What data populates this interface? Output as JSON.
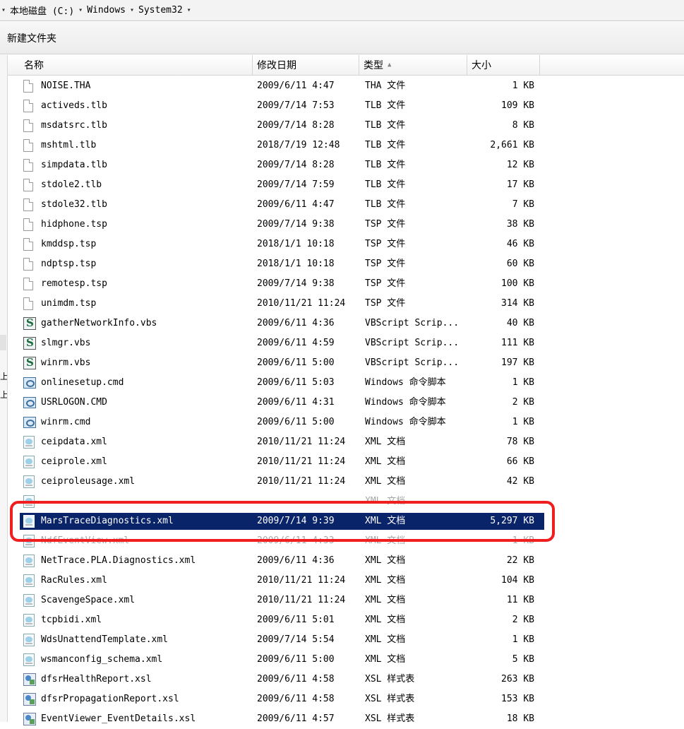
{
  "address_bar": {
    "crumbs": [
      "本地磁盘 (C:)",
      "Windows",
      "System32"
    ]
  },
  "toolbar": {
    "new_folder_label": "新建文件夹"
  },
  "columns": {
    "name": "名称",
    "date": "修改日期",
    "type": "类型",
    "size": "大小"
  },
  "sort_column": "type",
  "colors": {
    "selection": "#0a246a",
    "highlight_box": "#f01e1e"
  },
  "files": [
    {
      "name": "NOISE.THA",
      "date": "2009/6/11 4:47",
      "type": "THA 文件",
      "size": "1 KB",
      "icon": "file-icon"
    },
    {
      "name": "activeds.tlb",
      "date": "2009/7/14 7:53",
      "type": "TLB 文件",
      "size": "109 KB",
      "icon": "file-icon"
    },
    {
      "name": "msdatsrc.tlb",
      "date": "2009/7/14 8:28",
      "type": "TLB 文件",
      "size": "8 KB",
      "icon": "file-icon"
    },
    {
      "name": "mshtml.tlb",
      "date": "2018/7/19 12:48",
      "type": "TLB 文件",
      "size": "2,661 KB",
      "icon": "file-icon"
    },
    {
      "name": "simpdata.tlb",
      "date": "2009/7/14 8:28",
      "type": "TLB 文件",
      "size": "12 KB",
      "icon": "file-icon"
    },
    {
      "name": "stdole2.tlb",
      "date": "2009/7/14 7:59",
      "type": "TLB 文件",
      "size": "17 KB",
      "icon": "file-icon"
    },
    {
      "name": "stdole32.tlb",
      "date": "2009/6/11 4:47",
      "type": "TLB 文件",
      "size": "7 KB",
      "icon": "file-icon"
    },
    {
      "name": "hidphone.tsp",
      "date": "2009/7/14 9:38",
      "type": "TSP 文件",
      "size": "38 KB",
      "icon": "file-icon"
    },
    {
      "name": "kmddsp.tsp",
      "date": "2018/1/1 10:18",
      "type": "TSP 文件",
      "size": "46 KB",
      "icon": "file-icon"
    },
    {
      "name": "ndptsp.tsp",
      "date": "2018/1/1 10:18",
      "type": "TSP 文件",
      "size": "60 KB",
      "icon": "file-icon"
    },
    {
      "name": "remotesp.tsp",
      "date": "2009/7/14 9:38",
      "type": "TSP 文件",
      "size": "100 KB",
      "icon": "file-icon"
    },
    {
      "name": "unimdm.tsp",
      "date": "2010/11/21 11:24",
      "type": "TSP 文件",
      "size": "314 KB",
      "icon": "file-icon"
    },
    {
      "name": "gatherNetworkInfo.vbs",
      "date": "2009/6/11 4:36",
      "type": "VBScript Scrip...",
      "size": "40 KB",
      "icon": "vbscript-icon"
    },
    {
      "name": "slmgr.vbs",
      "date": "2009/6/11 4:59",
      "type": "VBScript Scrip...",
      "size": "111 KB",
      "icon": "vbscript-icon"
    },
    {
      "name": "winrm.vbs",
      "date": "2009/6/11 5:00",
      "type": "VBScript Scrip...",
      "size": "197 KB",
      "icon": "vbscript-icon"
    },
    {
      "name": "onlinesetup.cmd",
      "date": "2009/6/11 5:03",
      "type": "Windows 命令脚本",
      "size": "1 KB",
      "icon": "cmd-script-icon"
    },
    {
      "name": "USRLOGON.CMD",
      "date": "2009/6/11 4:31",
      "type": "Windows 命令脚本",
      "size": "2 KB",
      "icon": "cmd-script-icon"
    },
    {
      "name": "winrm.cmd",
      "date": "2009/6/11 5:00",
      "type": "Windows 命令脚本",
      "size": "1 KB",
      "icon": "cmd-script-icon"
    },
    {
      "name": "ceipdata.xml",
      "date": "2010/11/21 11:24",
      "type": "XML 文档",
      "size": "78 KB",
      "icon": "xml-document-icon"
    },
    {
      "name": "ceiprole.xml",
      "date": "2010/11/21 11:24",
      "type": "XML 文档",
      "size": "66 KB",
      "icon": "xml-document-icon"
    },
    {
      "name": "ceiproleusage.xml",
      "date": "2010/11/21 11:24",
      "type": "XML 文档",
      "size": "42 KB",
      "icon": "xml-document-icon"
    },
    {
      "name": "",
      "date": "",
      "type": "XML 文档",
      "size": "",
      "icon": "xml-document-icon",
      "obscured": true
    },
    {
      "name": "MarsTraceDiagnostics.xml",
      "date": "2009/7/14 9:39",
      "type": "XML 文档",
      "size": "5,297 KB",
      "icon": "xml-document-icon",
      "selected": true
    },
    {
      "name": "NdfEventView.xml",
      "date": "2009/6/11 4:33",
      "type": "XML 文档",
      "size": "1 KB",
      "icon": "xml-document-icon",
      "obscured": true
    },
    {
      "name": "NetTrace.PLA.Diagnostics.xml",
      "date": "2009/6/11 4:36",
      "type": "XML 文档",
      "size": "22 KB",
      "icon": "xml-document-icon"
    },
    {
      "name": "RacRules.xml",
      "date": "2010/11/21 11:24",
      "type": "XML 文档",
      "size": "104 KB",
      "icon": "xml-document-icon"
    },
    {
      "name": "ScavengeSpace.xml",
      "date": "2010/11/21 11:24",
      "type": "XML 文档",
      "size": "11 KB",
      "icon": "xml-document-icon"
    },
    {
      "name": "tcpbidi.xml",
      "date": "2009/6/11 5:01",
      "type": "XML 文档",
      "size": "2 KB",
      "icon": "xml-document-icon"
    },
    {
      "name": "WdsUnattendTemplate.xml",
      "date": "2009/7/14 5:54",
      "type": "XML 文档",
      "size": "1 KB",
      "icon": "xml-document-icon"
    },
    {
      "name": "wsmanconfig_schema.xml",
      "date": "2009/6/11 5:00",
      "type": "XML 文档",
      "size": "5 KB",
      "icon": "xml-document-icon"
    },
    {
      "name": "dfsrHealthReport.xsl",
      "date": "2009/6/11 4:58",
      "type": "XSL 样式表",
      "size": "263 KB",
      "icon": "xsl-stylesheet-icon"
    },
    {
      "name": "dfsrPropagationReport.xsl",
      "date": "2009/6/11 4:58",
      "type": "XSL 样式表",
      "size": "153 KB",
      "icon": "xsl-stylesheet-icon"
    },
    {
      "name": "EventViewer_EventDetails.xsl",
      "date": "2009/6/11 4:57",
      "type": "XSL 样式表",
      "size": "18 KB",
      "icon": "xsl-stylesheet-icon"
    }
  ]
}
